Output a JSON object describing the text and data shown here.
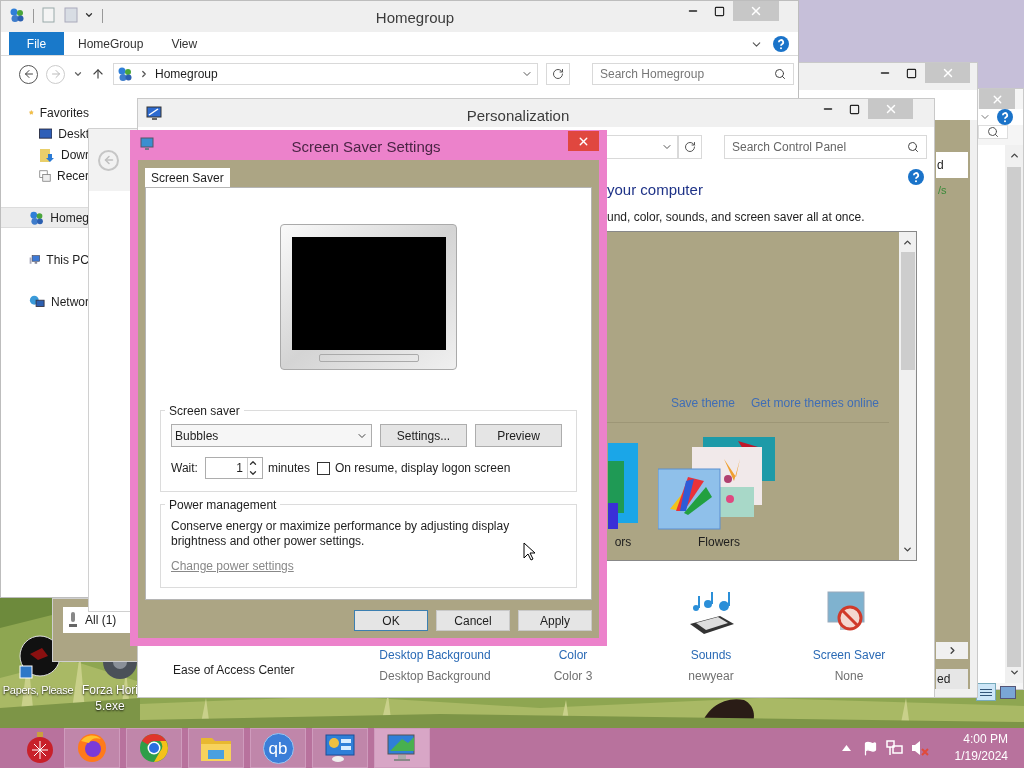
{
  "desktop": {
    "icons": [
      {
        "kind": "papers",
        "lines": [
          "Papers, Please"
        ]
      },
      {
        "kind": "forza",
        "lines": [
          "Forza Hori",
          "5.exe"
        ]
      }
    ]
  },
  "right_windows": {
    "header_fragment": "d",
    "speed_fragment": "/s",
    "button_fragment": "ed"
  },
  "explorer": {
    "title": "Homegroup",
    "ribbon_tabs": [
      {
        "label": "File",
        "kind": "menu"
      },
      {
        "label": "HomeGroup",
        "kind": "tab"
      },
      {
        "label": "View",
        "kind": "tab"
      }
    ],
    "address": "Homegroup",
    "search_placeholder": "Search Homegroup",
    "nav_items": [
      {
        "label": "Favorites",
        "kind": "favorites",
        "selected": false,
        "children": [
          {
            "label": "Deskt",
            "kind": "desktop",
            "selected": false
          },
          {
            "label": "Dowr",
            "kind": "downloads",
            "selected": false
          },
          {
            "label": "Recer",
            "kind": "recent",
            "selected": false
          }
        ]
      },
      {
        "label": "Homeg",
        "kind": "homegroup",
        "selected": true
      },
      {
        "label": "This PC",
        "kind": "pc",
        "selected": false
      },
      {
        "label": "Networ",
        "kind": "network",
        "selected": false
      }
    ]
  },
  "left_window": {
    "filter": "All (1)"
  },
  "personalization": {
    "title": "Personalization",
    "search_placeholder": "Search Control Panel",
    "heading": "your computer",
    "description": "und, color, sounds, and screen saver all at once.",
    "links": [
      "Save theme",
      "Get more themes online"
    ],
    "themes": [
      {
        "label": "ors",
        "kind": "partial"
      },
      {
        "label": "Flowers",
        "kind": "flowers"
      }
    ],
    "side_links": [
      "Ease of Access Center"
    ],
    "settings": [
      {
        "label": "Desktop Background",
        "value": "Desktop Background",
        "kind": "covered"
      },
      {
        "label": "Color",
        "value": "Color 3",
        "kind": "covered"
      },
      {
        "label": "Sounds",
        "value": "newyear",
        "kind": "sounds"
      },
      {
        "label": "Screen Saver",
        "value": "None",
        "kind": "screensaver"
      }
    ]
  },
  "dialog": {
    "title": "Screen Saver Settings",
    "tabs": [
      {
        "label": "Screen Saver",
        "selected": true
      }
    ],
    "screen_saver_group": {
      "legend": "Screen saver",
      "selection": "Bubbles",
      "buttons": [
        "Settings...",
        "Preview"
      ],
      "wait_label": "Wait:",
      "wait_value": "1",
      "wait_unit": "minutes",
      "logon_checkbox": {
        "label": "On resume, display logon screen",
        "checked": false
      }
    },
    "power_group": {
      "legend": "Power management",
      "text": "Conserve energy or maximize performance by adjusting display brightness and other power settings.",
      "link": "Change power settings"
    },
    "buttons": [
      {
        "label": "OK",
        "default": true
      },
      {
        "label": "Cancel",
        "default": false
      },
      {
        "label": "Apply",
        "default": false
      }
    ]
  },
  "taskbar": {
    "apps": [
      {
        "kind": "ornament",
        "active": false
      },
      {
        "kind": "firefox",
        "active": false
      },
      {
        "kind": "chrome",
        "active": false
      },
      {
        "kind": "explorer",
        "active": false
      },
      {
        "kind": "qbittorrent",
        "glyph": "qb",
        "active": false
      },
      {
        "kind": "control",
        "active": false
      },
      {
        "kind": "personalization",
        "active": true
      }
    ],
    "tray": {
      "muted": true,
      "time": "4:00 PM",
      "date": "1/19/2024"
    }
  }
}
